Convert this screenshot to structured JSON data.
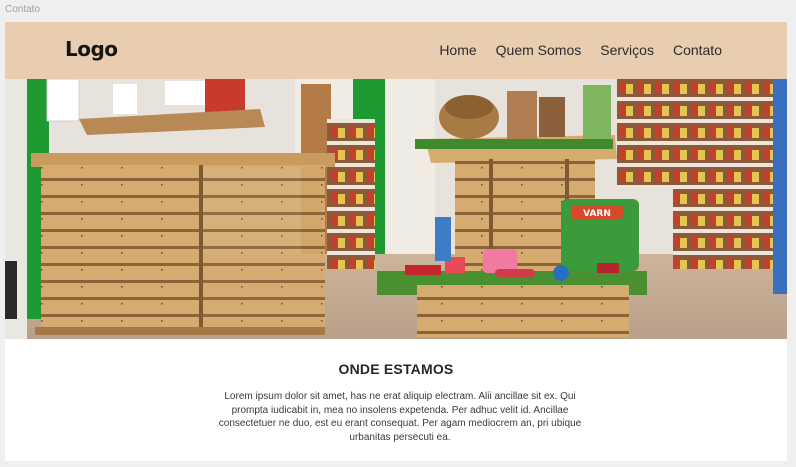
{
  "frame_label": "Contato",
  "header": {
    "logo": "Logo",
    "nav": [
      {
        "label": "Home"
      },
      {
        "label": "Quem Somos"
      },
      {
        "label": "Serviços"
      },
      {
        "label": "Contato"
      }
    ]
  },
  "hero": {
    "shop_sign": "VARN"
  },
  "location": {
    "title": "ONDE ESTAMOS",
    "text": "Lorem ipsum dolor sit amet, has ne erat aliquip electram. Alii ancillae sit ex. Qui prompta iudicabit in, mea no insolens expetenda. Per adhuc velit id. Ancillae consectetuer ne duo, est eu erant consequat. Per agam mediocrem an, pri ubique urbanitas persecuti ea."
  },
  "colors": {
    "header_bg": "#e8cdb0",
    "page_bg": "#efefef",
    "wood": "#d4a86b",
    "accent_green": "#1f9a32"
  }
}
